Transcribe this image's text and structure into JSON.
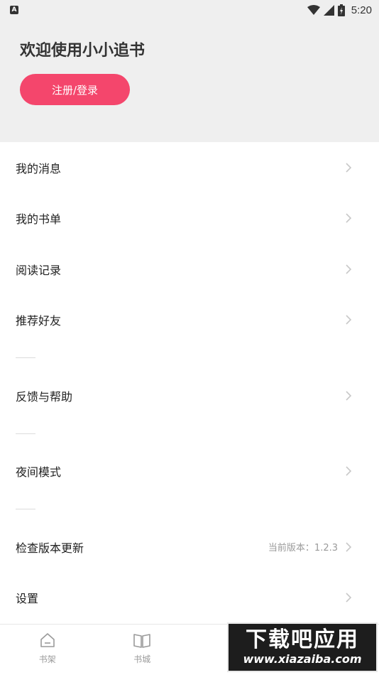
{
  "status_bar": {
    "app_badge": "A",
    "time": "5:20"
  },
  "header": {
    "welcome_text": "欢迎使用小小追书",
    "login_button": "注册/登录",
    "accent_color": "#f4466c"
  },
  "menu": {
    "items": [
      {
        "label": "我的消息"
      },
      {
        "label": "我的书单"
      },
      {
        "label": "阅读记录"
      },
      {
        "label": "推荐好友"
      },
      {
        "label": "反馈与帮助"
      },
      {
        "label": "夜间模式"
      },
      {
        "label": "检查版本更新",
        "value": "当前版本：1.2.3"
      },
      {
        "label": "设置"
      }
    ]
  },
  "tabbar": {
    "tabs": [
      {
        "label": "书架",
        "icon": "home-icon"
      },
      {
        "label": "书城",
        "icon": "book-icon"
      }
    ]
  },
  "watermark": {
    "title": "下载吧应用",
    "url": "www.xiazaiba.com"
  }
}
